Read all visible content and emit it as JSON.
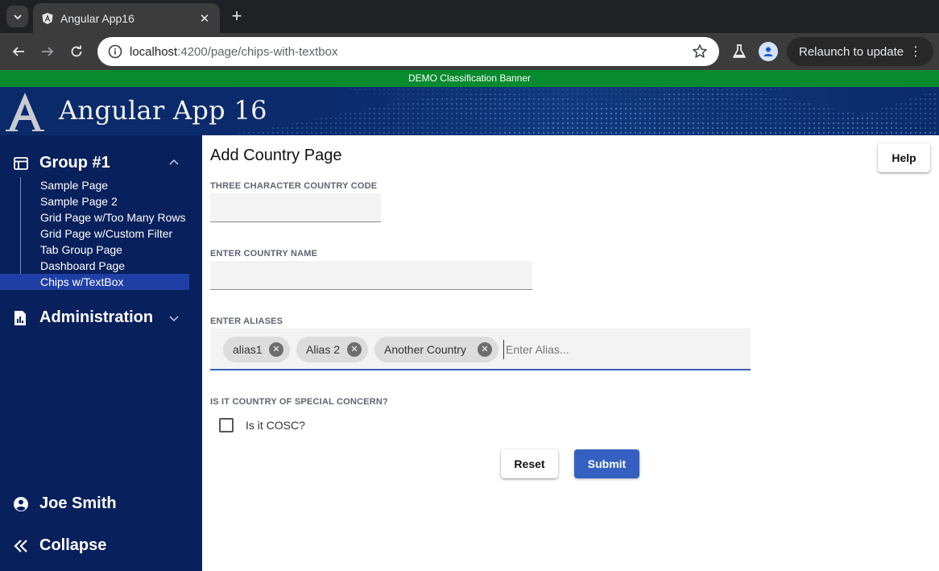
{
  "browser": {
    "tab_title": "Angular App16",
    "tab_close": "✕",
    "new_tab": "+",
    "url_host": "localhost",
    "url_path": ":4200/page/chips-with-textbox",
    "relaunch_label": "Relaunch to update",
    "relaunch_menu": "⋮"
  },
  "banner": {
    "text": "DEMO Classification Banner",
    "color": "#088a2e"
  },
  "header": {
    "app_title": "Angular App 16",
    "logo_letter": "A"
  },
  "sidebar": {
    "group": {
      "label": "Group #1",
      "icon": "layout-icon",
      "expanded": true
    },
    "items": [
      {
        "label": "Sample Page"
      },
      {
        "label": "Sample Page 2"
      },
      {
        "label": "Grid Page w/Too Many Rows"
      },
      {
        "label": "Grid Page w/Custom Filter"
      },
      {
        "label": "Tab Group Page"
      },
      {
        "label": "Dashboard Page"
      },
      {
        "label": "Chips w/TextBox",
        "active": true
      }
    ],
    "admin": {
      "label": "Administration",
      "icon": "report-icon"
    },
    "user": {
      "label": "Joe Smith",
      "icon": "account-circle-icon"
    },
    "collapse": {
      "label": "Collapse",
      "icon": "double-chevron-left-icon"
    }
  },
  "main": {
    "page_title": "Add Country Page",
    "help_label": "Help",
    "country_code_label": "THREE CHARACTER COUNTRY CODE",
    "country_code_value": "",
    "country_name_label": "ENTER COUNTRY NAME",
    "country_name_value": "",
    "aliases_label": "ENTER ALIASES",
    "chips": [
      {
        "label": "alias1"
      },
      {
        "label": "Alias 2"
      },
      {
        "label": "Another Country"
      }
    ],
    "alias_placeholder": "Enter Alias...",
    "cosc_label": "IS IT COUNTRY OF SPECIAL CONCERN?",
    "cosc_checkbox_label": "Is it COSC?",
    "cosc_checked": false,
    "reset_label": "Reset",
    "submit_label": "Submit"
  },
  "colors": {
    "sidebar_bg": "#08205c",
    "active_item": "#1f3fa6",
    "primary": "#3461c1"
  }
}
